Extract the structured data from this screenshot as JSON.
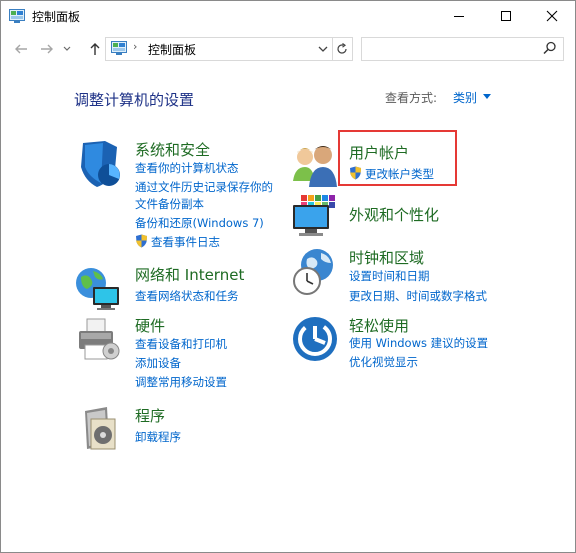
{
  "window": {
    "title": "控制面板"
  },
  "address": {
    "path_item": "控制面板",
    "search_placeholder": ""
  },
  "content": {
    "heading": "调整计算机的设置",
    "view_by_label": "查看方式:",
    "view_by_value": "类别"
  },
  "categories": {
    "system_security": {
      "title": "系统和安全",
      "links": [
        "查看你的计算机状态",
        "通过文件历史记录保存你的",
        "文件备份副本",
        "备份和还原(Windows 7)",
        "查看事件日志"
      ]
    },
    "network": {
      "title": "网络和 Internet",
      "links": [
        "查看网络状态和任务"
      ]
    },
    "hardware": {
      "title": "硬件",
      "links": [
        "查看设备和打印机",
        "添加设备",
        "调整常用移动设置"
      ]
    },
    "programs": {
      "title": "程序",
      "links": [
        "卸载程序"
      ]
    },
    "user_accounts": {
      "title": "用户帐户",
      "links": [
        "更改帐户类型"
      ]
    },
    "appearance": {
      "title": "外观和个性化",
      "links": []
    },
    "clock_region": {
      "title": "时钟和区域",
      "links": [
        "设置时间和日期",
        "更改日期、时间或数字格式"
      ]
    },
    "ease_access": {
      "title": "轻松使用",
      "links": [
        "使用 Windows 建议的设置",
        "优化视觉显示"
      ]
    }
  },
  "colors": {
    "category_title": "#1e6b23",
    "link": "#0066cc",
    "heading": "#1e3287",
    "highlight": "#e53935"
  }
}
